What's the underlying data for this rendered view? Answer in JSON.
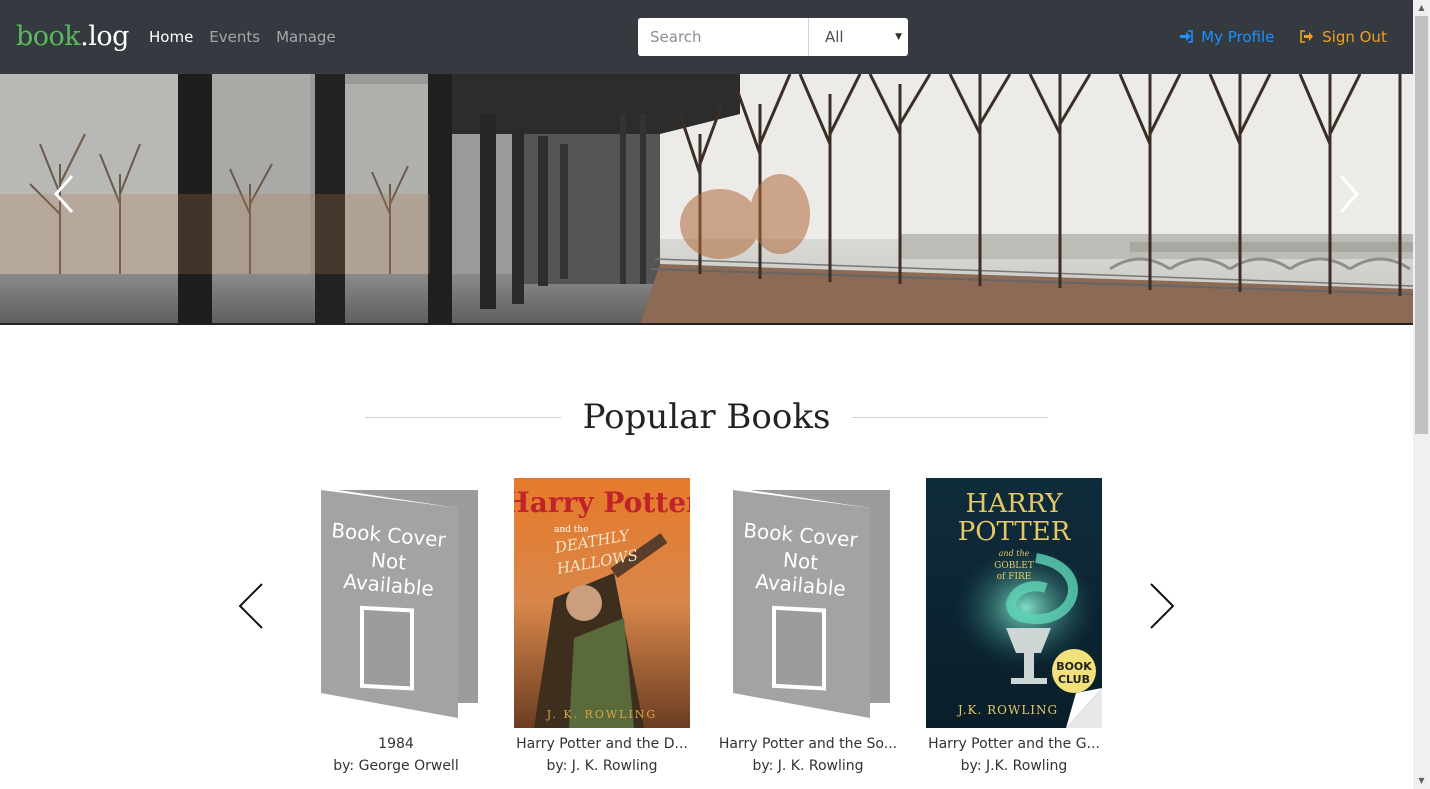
{
  "brand": {
    "part1": "book",
    "part2": ".log"
  },
  "nav": {
    "home": "Home",
    "events": "Events",
    "manage": "Manage"
  },
  "search": {
    "placeholder": "Search",
    "filter_selected": "All"
  },
  "account": {
    "profile": "My Profile",
    "signout": "Sign Out"
  },
  "section": {
    "title": "Popular Books"
  },
  "books": [
    {
      "title": "1984",
      "author": "by: George Orwell",
      "cover": "placeholder",
      "placeholder_text": [
        "Book Cover",
        "Not",
        "Available"
      ]
    },
    {
      "title": "Harry Potter and the D...",
      "author": "by: J. K. Rowling",
      "cover": "deathly-hallows",
      "cover_text": [
        "Harry Potter",
        "and the",
        "DEATHLY",
        "HALLOWS",
        "J. K. ROWLING"
      ]
    },
    {
      "title": "Harry Potter and the So...",
      "author": "by: J. K. Rowling",
      "cover": "placeholder",
      "placeholder_text": [
        "Book Cover",
        "Not",
        "Available"
      ]
    },
    {
      "title": "Harry Potter and the G...",
      "author": "by: J.K. Rowling",
      "cover": "goblet-of-fire",
      "cover_text": [
        "HARRY",
        "POTTER",
        "and the",
        "GOBLET",
        "of FIRE",
        "BOOK",
        "CLUB",
        "J.K. ROWLING"
      ]
    }
  ],
  "colors": {
    "navbar": "#343a40",
    "brand_green": "#5cb85c",
    "profile_blue": "#1e90ff",
    "signout_orange": "#f0a020"
  }
}
